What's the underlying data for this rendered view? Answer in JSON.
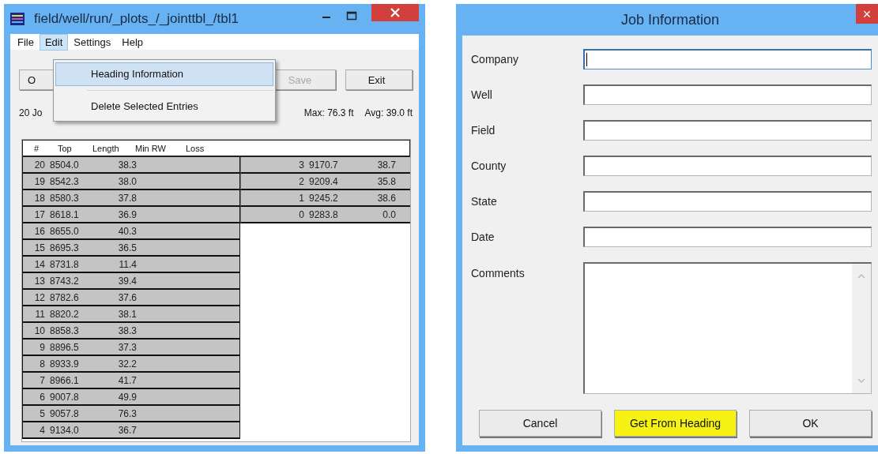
{
  "main_window": {
    "title": "field/well/run/_plots_/_jointtbl_/tbl1",
    "menu": [
      {
        "label": "File",
        "selected": false
      },
      {
        "label": "Edit",
        "selected": true
      },
      {
        "label": "Settings",
        "selected": false
      },
      {
        "label": "Help",
        "selected": false
      }
    ],
    "toolbar": [
      {
        "label": "O",
        "disabled": false
      },
      {
        "label": "Save",
        "disabled": true
      },
      {
        "label": "Exit",
        "disabled": false
      }
    ],
    "status": [
      "20 Jo",
      "Max: 76.3 ft",
      "Avg: 39.0 ft"
    ],
    "edit_menu": [
      {
        "label": "Heading Information",
        "selected": true
      },
      {
        "label": "Delete Selected Entries",
        "selected": false
      }
    ],
    "table": {
      "columns": [
        "#",
        "Top",
        "Length",
        "Min RW",
        "Loss"
      ],
      "left_rows": [
        [
          "20",
          "8504.0",
          "38.3"
        ],
        [
          "19",
          "8542.3",
          "38.0"
        ],
        [
          "18",
          "8580.3",
          "37.8"
        ],
        [
          "17",
          "8618.1",
          "36.9"
        ],
        [
          "16",
          "8655.0",
          "40.3"
        ],
        [
          "15",
          "8695.3",
          "36.5"
        ],
        [
          "14",
          "8731.8",
          "11.4"
        ],
        [
          "13",
          "8743.2",
          "39.4"
        ],
        [
          "12",
          "8782.6",
          "37.6"
        ],
        [
          "11",
          "8820.2",
          "38.1"
        ],
        [
          "10",
          "8858.3",
          "38.3"
        ],
        [
          "9",
          "8896.5",
          "37.3"
        ],
        [
          "8",
          "8933.9",
          "32.2"
        ],
        [
          "7",
          "8966.1",
          "41.7"
        ],
        [
          "6",
          "9007.8",
          "49.9"
        ],
        [
          "5",
          "9057.8",
          "76.3"
        ],
        [
          "4",
          "9134.0",
          "36.7"
        ]
      ],
      "right_rows": [
        [
          "3",
          "9170.7",
          "38.7"
        ],
        [
          "2",
          "9209.4",
          "35.8"
        ],
        [
          "1",
          "9245.2",
          "38.6"
        ],
        [
          "0",
          "9283.8",
          "0.0"
        ]
      ]
    }
  },
  "dialog": {
    "title": "Job Information",
    "close": "×",
    "fields": [
      {
        "label": "Company",
        "kind": "line",
        "focused": true
      },
      {
        "label": "Well",
        "kind": "line",
        "focused": false
      },
      {
        "label": "Field",
        "kind": "line",
        "focused": false
      },
      {
        "label": "County",
        "kind": "line",
        "focused": false
      },
      {
        "label": "State",
        "kind": "line",
        "focused": false
      },
      {
        "label": "Date",
        "kind": "line",
        "focused": false
      },
      {
        "label": "Comments",
        "kind": "multiline",
        "focused": false
      }
    ],
    "buttons": [
      {
        "label": "Cancel",
        "highlighted": false
      },
      {
        "label": "Get From Heading",
        "highlighted": true
      },
      {
        "label": "OK",
        "highlighted": false
      }
    ]
  }
}
